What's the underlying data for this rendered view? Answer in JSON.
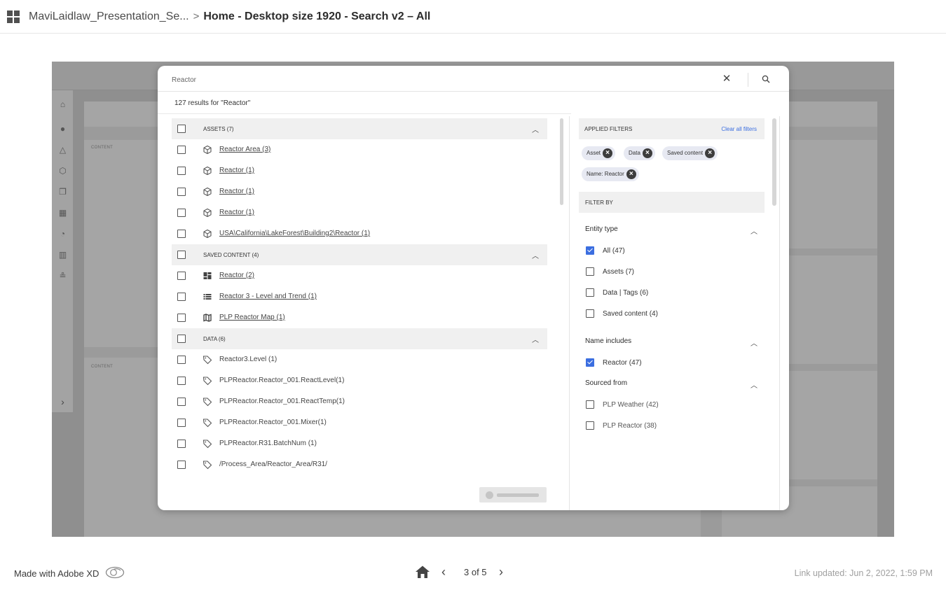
{
  "header": {
    "parent": "MaviLaidlaw_Presentation_Se...",
    "separator": ">",
    "current": "Home - Desktop size 1920 - Search v2 – All"
  },
  "artboard": {
    "content_label_1": "CONTENT",
    "content_label_2": "CONTENT"
  },
  "search": {
    "query": "Reactor",
    "results_text": "127 results for \"Reactor\""
  },
  "groups": [
    {
      "title": "ASSETS (7)",
      "items": [
        {
          "icon": "cube-icon",
          "text": "Reactor Area (3)"
        },
        {
          "icon": "cube-icon",
          "text": "Reactor (1)"
        },
        {
          "icon": "cube-icon",
          "text": "Reactor (1)"
        },
        {
          "icon": "cube-icon",
          "text": "Reactor (1)"
        },
        {
          "icon": "cube-icon",
          "text": "USA\\California\\LakeForest\\Building2\\Reactor (1)"
        }
      ]
    },
    {
      "title": "SAVED CONTENT (4)",
      "items": [
        {
          "icon": "dashboard-icon",
          "text": "Reactor (2)"
        },
        {
          "icon": "list-icon",
          "text": "Reactor 3 - Level and Trend (1)"
        },
        {
          "icon": "map-icon",
          "text": "PLP Reactor Map (1)"
        }
      ]
    },
    {
      "title": "DATA (6)",
      "items": [
        {
          "icon": "tag-icon",
          "text": "Reactor3.Level (1)"
        },
        {
          "icon": "tag-icon",
          "text": "PLPReactor.Reactor_001.ReactLevel(1)"
        },
        {
          "icon": "tag-icon",
          "text": "PLPReactor.Reactor_001.ReactTemp(1)"
        },
        {
          "icon": "tag-icon",
          "text": "PLPReactor.Reactor_001.Mixer(1)"
        },
        {
          "icon": "tag-icon",
          "text": "PLPReactor.R31.BatchNum (1)"
        },
        {
          "icon": "tag-icon",
          "text": "/Process_Area/Reactor_Area/R31/"
        }
      ]
    }
  ],
  "filters": {
    "applied_title": "APPLIED FILTERS",
    "clear_all": "Clear all filters",
    "chips": [
      "Asset",
      "Data",
      "Saved content",
      "Name: Reactor"
    ],
    "filter_by": "FILTER BY",
    "entity_type": {
      "title": "Entity type",
      "options": [
        {
          "label": "All (47)",
          "checked": true
        },
        {
          "label": "Assets (7)",
          "checked": false
        },
        {
          "label": "Data | Tags (6)",
          "checked": false
        },
        {
          "label": "Saved content (4)",
          "checked": false
        }
      ]
    },
    "name_includes": {
      "title": "Name includes",
      "options": [
        {
          "label": "Reactor (47)",
          "checked": true
        }
      ]
    },
    "sourced_from": {
      "title": "Sourced from",
      "options": [
        {
          "label": "PLP Weather (42)",
          "checked": false
        },
        {
          "label": "PLP Reactor (38)",
          "checked": false
        }
      ]
    }
  },
  "footer": {
    "made_with": "Made with Adobe XD",
    "page_indicator": "3 of 5",
    "link_updated": "Link updated: Jun 2, 2022, 1:59 PM"
  },
  "colors": {
    "accent": "#3b6ee0",
    "chip_bg": "#e7e9f2",
    "group_bg": "#f0f0f0"
  }
}
